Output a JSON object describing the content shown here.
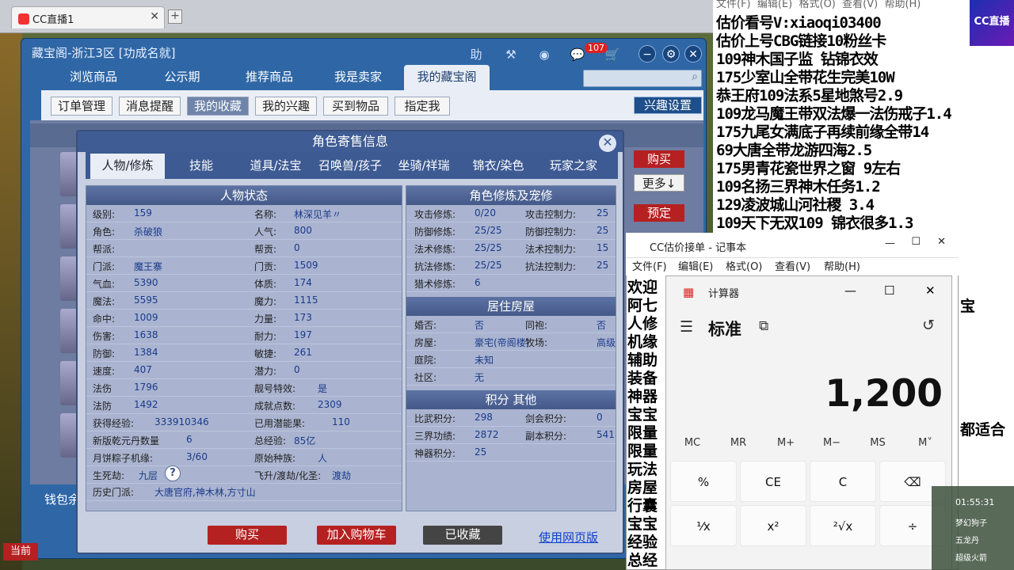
{
  "browser": {
    "tab_title": "CC直播1",
    "new_tab": "+"
  },
  "cbg": {
    "title": "藏宝阁-浙江3区 [功成名就]",
    "help": "助",
    "notify_count": "107",
    "nav_tabs": [
      "浏览商品",
      "公示期",
      "推荐商品",
      "我是卖家",
      "我的藏宝阁"
    ],
    "sub_tabs": [
      "订单管理",
      "消息提醒",
      "我的收藏",
      "我的兴趣",
      "买到物品",
      "指定我"
    ],
    "interest_setting": "兴趣设置",
    "side_buttons": {
      "buy": "购买",
      "more": "更多↓",
      "reserve": "预定"
    },
    "wallet": "钱包余"
  },
  "modal": {
    "title": "角色寄售信息",
    "tabs": [
      "人物/修炼",
      "技能",
      "道具/法宝",
      "召唤兽/孩子",
      "坐骑/祥瑞",
      "锦衣/染色",
      "玩家之家"
    ],
    "status_header": "人物状态",
    "status_left": [
      {
        "label": "级别:",
        "value": "159"
      },
      {
        "label": "角色:",
        "value": "杀破狼"
      },
      {
        "label": "帮派:",
        "value": ""
      },
      {
        "label": "门派:",
        "value": "魔王寨"
      },
      {
        "label": "气血:",
        "value": "5390"
      },
      {
        "label": "魔法:",
        "value": "5595"
      },
      {
        "label": "命中:",
        "value": "1009"
      },
      {
        "label": "伤害:",
        "value": "1638"
      },
      {
        "label": "防御:",
        "value": "1384"
      },
      {
        "label": "速度:",
        "value": "407"
      },
      {
        "label": "法伤",
        "value": "1796"
      },
      {
        "label": "法防",
        "value": "1492"
      },
      {
        "label": "获得经验:",
        "value": "333910346"
      },
      {
        "label": "新版乾元丹数量",
        "value": "6"
      },
      {
        "label": "月饼粽子机缘:",
        "value": "3/60"
      },
      {
        "label": "生死劫:",
        "value": "九层"
      }
    ],
    "status_right": [
      {
        "label": "名称:",
        "value": "林深见羊〃"
      },
      {
        "label": "人气:",
        "value": "800"
      },
      {
        "label": "帮贡:",
        "value": "0"
      },
      {
        "label": "门贡:",
        "value": "1509"
      },
      {
        "label": "体质:",
        "value": "174"
      },
      {
        "label": "魔力:",
        "value": "1115"
      },
      {
        "label": "力量:",
        "value": "173"
      },
      {
        "label": "耐力:",
        "value": "197"
      },
      {
        "label": "敏捷:",
        "value": "261"
      },
      {
        "label": "潜力:",
        "value": "0"
      },
      {
        "label": "靓号特效:",
        "value": "是"
      },
      {
        "label": "成就点数:",
        "value": "2309"
      },
      {
        "label": "已用潜能果:",
        "value": "110"
      },
      {
        "label": "总经验:",
        "value": "85亿"
      },
      {
        "label": "原始种族:",
        "value": "人"
      },
      {
        "label": "飞升/渡劫/化圣:",
        "value": "渡劫"
      }
    ],
    "history_label": "历史门派:",
    "history_value": "大唐官府,神木林,方寸山",
    "cultivation_header": "角色修炼及宠修",
    "cultivation": [
      {
        "l1": "攻击修炼:",
        "v1": "0/20",
        "l2": "攻击控制力:",
        "v2": "25"
      },
      {
        "l1": "防御修炼:",
        "v1": "25/25",
        "l2": "防御控制力:",
        "v2": "25"
      },
      {
        "l1": "法术修炼:",
        "v1": "25/25",
        "l2": "法术控制力:",
        "v2": "15"
      },
      {
        "l1": "抗法修炼:",
        "v1": "25/25",
        "l2": "抗法控制力:",
        "v2": "25"
      },
      {
        "l1": "猎术修炼:",
        "v1": "6",
        "l2": "",
        "v2": ""
      }
    ],
    "house_header": "居住房屋",
    "house": [
      {
        "l1": "婚否:",
        "v1": "否",
        "l2": "同袍:",
        "v2": "否"
      },
      {
        "l1": "房屋:",
        "v1": "豪宅(帝阁楼)",
        "l2": "牧场:",
        "v2": "高级"
      },
      {
        "l1": "庭院:",
        "v1": "未知",
        "l2": "",
        "v2": ""
      },
      {
        "l1": "社区:",
        "v1": "无",
        "l2": "",
        "v2": ""
      }
    ],
    "points_header": "积分 其他",
    "points": [
      {
        "l1": "比武积分:",
        "v1": "298",
        "l2": "剑会积分:",
        "v2": "0"
      },
      {
        "l1": "三界功绩:",
        "v1": "2872",
        "l2": "副本积分:",
        "v2": "541"
      },
      {
        "l1": "神器积分:",
        "v1": "25",
        "l2": "",
        "v2": ""
      }
    ],
    "buttons": {
      "buy": "购买",
      "add_cart": "加入购物车",
      "collected": "已收藏",
      "web": "使用网页版"
    }
  },
  "stream_text": [
    "估价看号V:xiaoqi03400",
    "估价上号CBG链接10粉丝卡",
    "109神木国子监  钻锦衣效",
    "175少室山全带花生完美10W",
    "恭王府109法系5星地煞号2.9",
    "109龙马魔王带双法爆一法伤戒子1.4",
    "175九尾女满底子再续前缘全带14",
    "69大唐全带龙游四海2.5",
    "175男青花瓷世界之窗  9左右",
    "109名扬三界神木任务1.2",
    "129凌波城山河社稷  3.4",
    "109天下无双109  锦衣很多1.3"
  ],
  "notepad": {
    "title": "CC估价接单 - 记事本",
    "menu": [
      "文件(F)",
      "编辑(E)",
      "格式(O)",
      "查看(V)",
      "帮助(H)"
    ],
    "lines": [
      "欢迎",
      "阿七",
      "人修",
      "机缘",
      "辅助",
      "装备",
      "神器",
      "宝宝",
      "限量",
      "限量",
      "玩法",
      "房屋",
      "行囊",
      "宝宝",
      "经验",
      "总经"
    ],
    "right_fragments": [
      "宝",
      "都适合"
    ]
  },
  "calculator": {
    "title": "计算器",
    "mode": "标准",
    "display": "1,200",
    "memory_keys": [
      "MC",
      "MR",
      "M+",
      "M−",
      "MS",
      "M˅"
    ],
    "keys_row1": [
      "%",
      "CE",
      "C",
      "⌫"
    ],
    "keys_row2": [
      "¹⁄x",
      "x²",
      "²√x",
      "÷"
    ]
  },
  "widget": {
    "time": "01:55:31",
    "items": [
      "梦幻狗子",
      "五龙丹",
      "超级火箭"
    ]
  },
  "bottom_game": {
    "label": "当前"
  }
}
